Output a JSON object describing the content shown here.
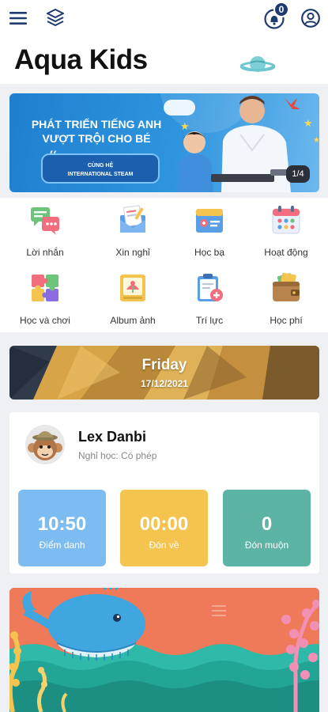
{
  "header": {
    "app_title": "Aqua Kids",
    "notification_count": "0"
  },
  "banner": {
    "headline_line1": "PHÁT TRIỂN TIẾNG ANH",
    "headline_line2": "VƯỢT TRỘI CHO BÉ",
    "pill_line1": "CÙNG HỆ",
    "pill_line2": "INTERNATIONAL STEAM",
    "page_indicator": "1/4"
  },
  "menu": {
    "items": [
      {
        "label": "Lời nhắn",
        "icon": "message-icon"
      },
      {
        "label": "Xin nghỉ",
        "icon": "leave-request-icon"
      },
      {
        "label": "Học bạ",
        "icon": "report-card-icon"
      },
      {
        "label": "Hoạt động",
        "icon": "calendar-icon"
      },
      {
        "label": "Học và chơi",
        "icon": "puzzle-icon"
      },
      {
        "label": "Album ảnh",
        "icon": "photo-album-icon"
      },
      {
        "label": "Trí lực",
        "icon": "health-clipboard-icon"
      },
      {
        "label": "Học phí",
        "icon": "wallet-icon"
      }
    ]
  },
  "date_card": {
    "day": "Friday",
    "date": "17/12/2021"
  },
  "student": {
    "name": "Lex Danbi",
    "status": "Nghỉ học: Có phép",
    "stats": [
      {
        "value": "10:50",
        "label": "Điểm danh",
        "color": "#7dbcf0"
      },
      {
        "value": "00:00",
        "label": "Đón về",
        "color": "#f4c44e"
      },
      {
        "value": "0",
        "label": "Đón muộn",
        "color": "#5cb5a4"
      }
    ]
  },
  "colors": {
    "header_icons": "#1e3a6e",
    "bottom_card": "#ef7a5a"
  }
}
